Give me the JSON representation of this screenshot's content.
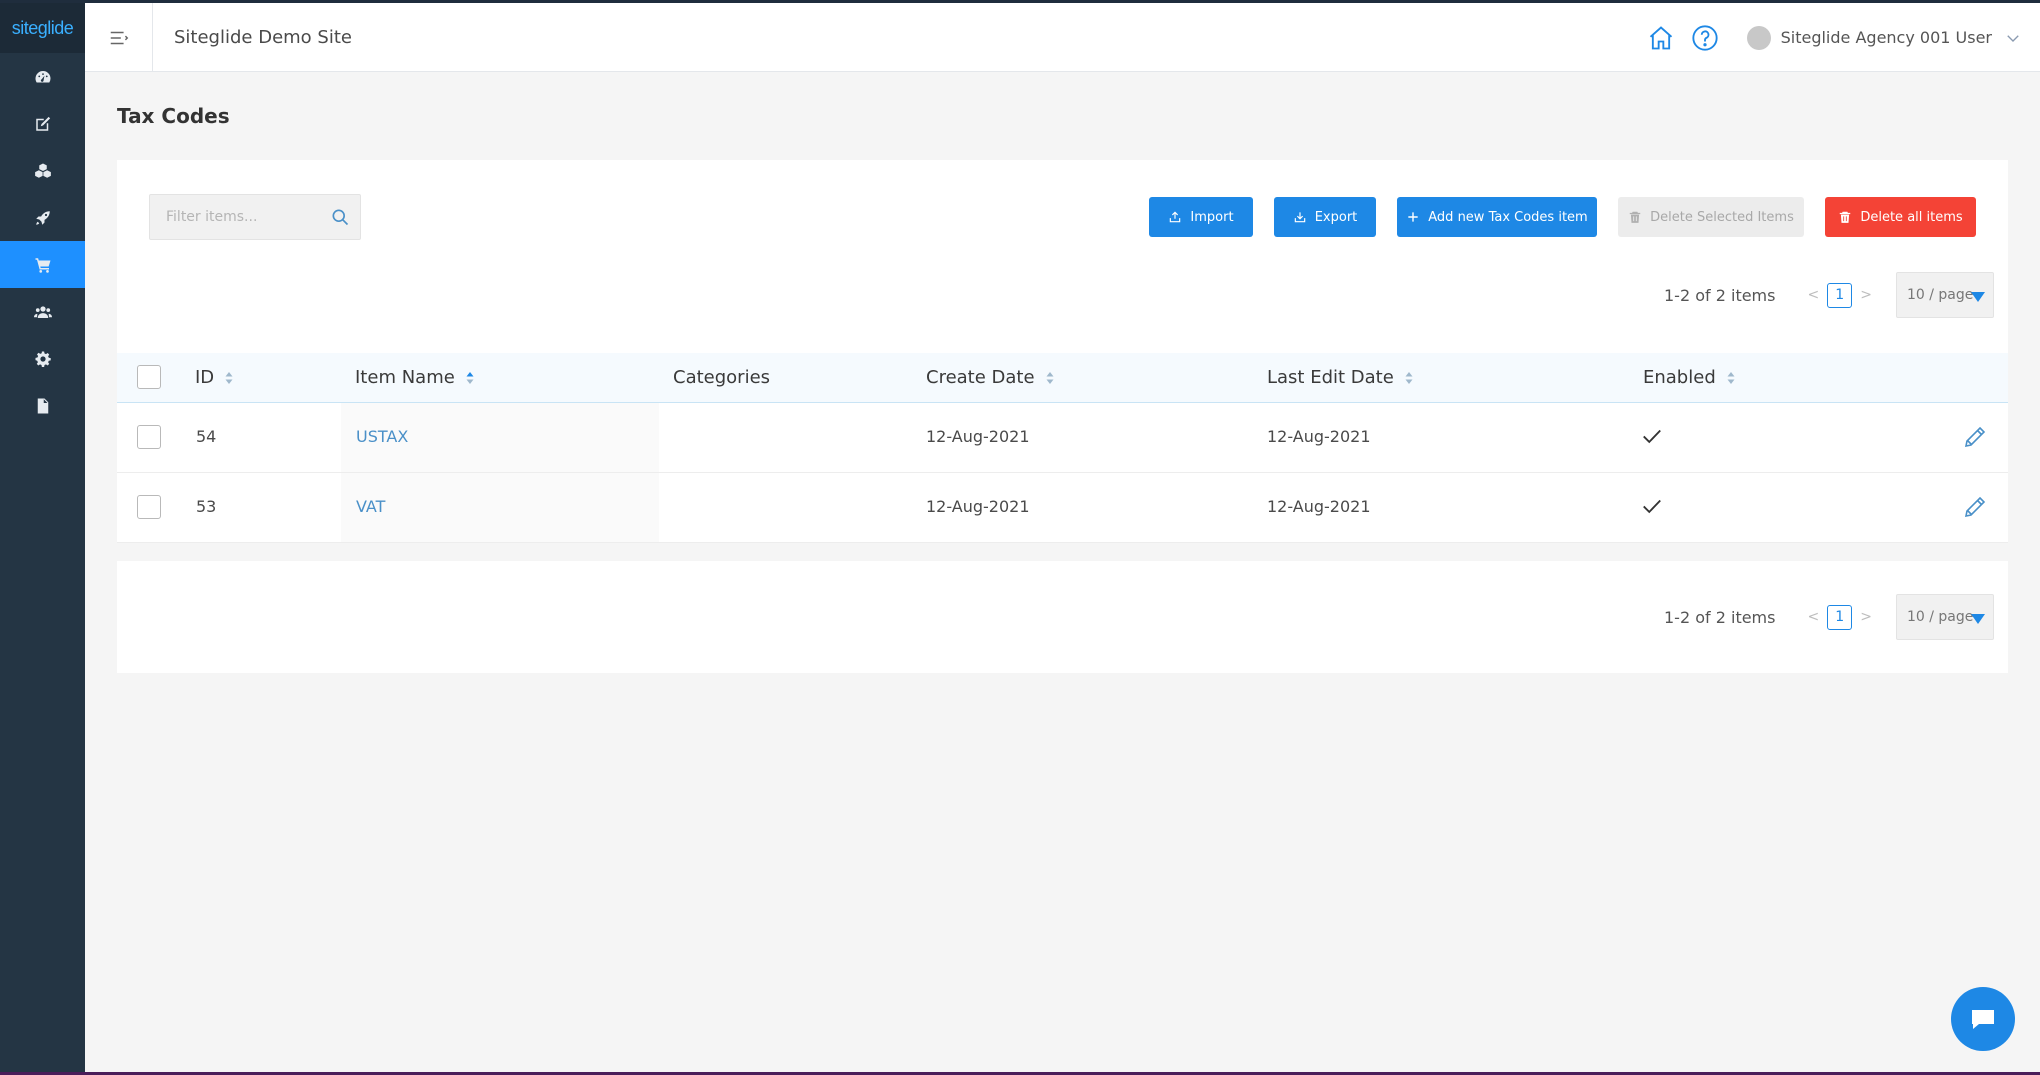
{
  "app": {
    "logo_text": "siteglide",
    "site_title": "Siteglide Demo Site"
  },
  "sidebar": {
    "items": [
      {
        "icon": "dashboard-icon",
        "active": false
      },
      {
        "icon": "edit-icon",
        "active": false
      },
      {
        "icon": "modules-icon",
        "active": false
      },
      {
        "icon": "rocket-icon",
        "active": false
      },
      {
        "icon": "cart-icon",
        "active": true
      },
      {
        "icon": "users-icon",
        "active": false
      },
      {
        "icon": "gear-icon",
        "active": false
      },
      {
        "icon": "file-icon",
        "active": false
      }
    ]
  },
  "header": {
    "user_name": "Siteglide Agency 001 User"
  },
  "page": {
    "title": "Tax Codes"
  },
  "toolbar": {
    "filter_placeholder": "Filter items...",
    "import_label": "Import",
    "export_label": "Export",
    "add_label": "Add new Tax Codes item",
    "delete_selected_label": "Delete Selected Items",
    "delete_all_label": "Delete all items"
  },
  "pagination": {
    "count_text": "1-2 of 2 items",
    "current_page": "1",
    "per_page": "10 / page",
    "prev": "<",
    "next": ">"
  },
  "table": {
    "columns": [
      "ID",
      "Item Name",
      "Categories",
      "Create Date",
      "Last Edit Date",
      "Enabled"
    ],
    "rows": [
      {
        "id": "54",
        "name": "USTAX",
        "categories": "",
        "create_date": "12-Aug-2021",
        "last_edit": "12-Aug-2021",
        "enabled": true
      },
      {
        "id": "53",
        "name": "VAT",
        "categories": "",
        "create_date": "12-Aug-2021",
        "last_edit": "12-Aug-2021",
        "enabled": true
      }
    ]
  },
  "colors": {
    "accent": "#1e88e5",
    "danger": "#f44336",
    "sidebar": "#243544",
    "link": "#4a90c8"
  }
}
